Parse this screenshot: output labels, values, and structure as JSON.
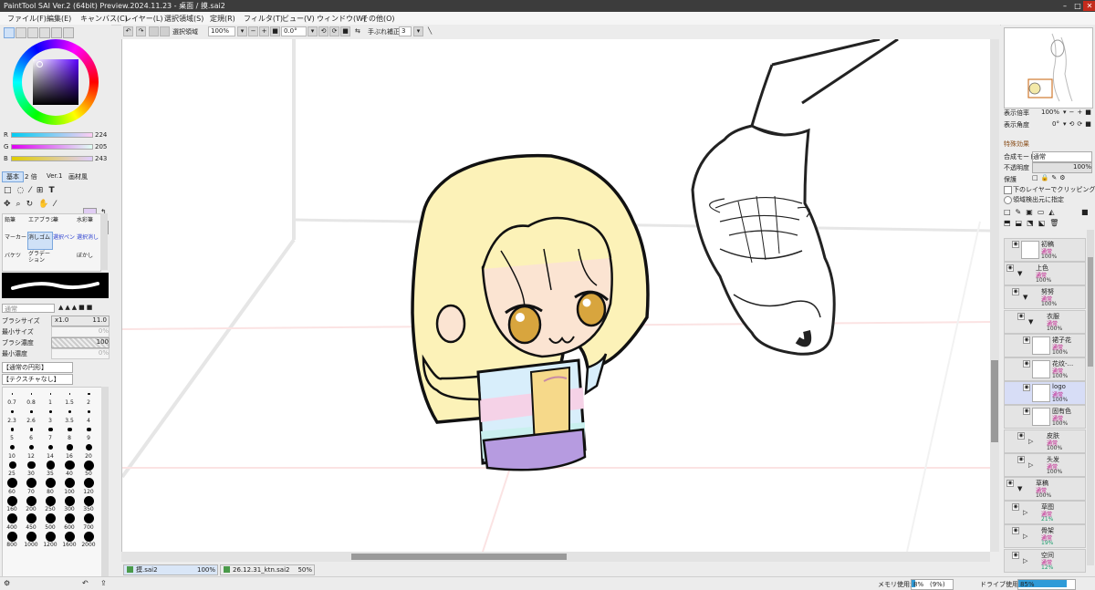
{
  "window": {
    "title": "PaintTool SAI Ver.2 (64bit) Preview.2024.11.23 - 桌面 / 摸.sai2",
    "minimize": "–",
    "maximize": "□",
    "close": "✕"
  },
  "menu": [
    "ファイル(F)",
    "編集(E)",
    "キャンバス(C)",
    "レイヤー(L)",
    "選択領域(S)",
    "定規(R)",
    "フィルタ(T)",
    "ビュー(V)",
    "ウィンドウ(W)",
    "その他(O)"
  ],
  "toolbar": {
    "selection_label": "選択領域",
    "zoom_value": "100%",
    "rotation_value": "0.0°",
    "stabilizer_label": "手ぶれ補正",
    "stabilizer_value": "3"
  },
  "color": {
    "r_label": "R",
    "r_value": "224",
    "g_label": "G",
    "g_value": "205",
    "b_label": "B",
    "b_value": "243",
    "current_color": "#e0cdf3"
  },
  "tool_tabs": [
    "基本",
    "2 倍",
    "Ver.1",
    "画材風"
  ],
  "tools": [
    "鉛筆",
    "エアブラシ",
    "筆",
    "水彩筆",
    "マーカー",
    "消しゴム",
    "選択ペン",
    "選択消し",
    "バケツ",
    "グラデーション",
    "ぼかし"
  ],
  "brush": {
    "mode": "通常",
    "size_label": "ブラシサイズ",
    "size_mult": "x1.0",
    "size_value": "11.0",
    "min_size_label": "最小サイズ",
    "min_size_value": "0%",
    "density_label": "ブラシ濃度",
    "density_value": "100",
    "min_density_label": "最小濃度",
    "min_density_value": "0%",
    "shape": "【通常の円形】",
    "texture": "【テクスチャなし】",
    "sizes": [
      "0.7",
      "0.8",
      "1",
      "1.5",
      "2",
      "2.3",
      "2.6",
      "3",
      "3.5",
      "4",
      "5",
      "6",
      "7",
      "8",
      "9",
      "10",
      "12",
      "14",
      "16",
      "20",
      "25",
      "30",
      "35",
      "40",
      "50",
      "60",
      "70",
      "80",
      "100",
      "120",
      "160",
      "200",
      "250",
      "300",
      "350",
      "400",
      "450",
      "500",
      "600",
      "700",
      "800",
      "1000",
      "1200",
      "1600",
      "2000"
    ]
  },
  "navigator": {
    "zoom_label": "表示倍率",
    "zoom_value": "100%",
    "angle_label": "表示角度",
    "angle_value": "0°"
  },
  "layer_props": {
    "effects": "特殊効果",
    "blend_label": "合成モード",
    "blend_value": "通常",
    "opacity_label": "不透明度",
    "opacity_value": "100%",
    "protect_label": "保護",
    "clip_label": "下のレイヤーでクリッピング",
    "detect_label": "領域検出元に指定"
  },
  "layers": [
    {
      "name": "初稿",
      "mode": "通常",
      "opacity": "100%",
      "folder": false
    },
    {
      "name": "上色",
      "mode": "通常",
      "opacity": "100%",
      "folder": true
    },
    {
      "name": "努努",
      "mode": "通常",
      "opacity": "100%",
      "folder": true
    },
    {
      "name": "衣服",
      "mode": "通常",
      "opacity": "100%",
      "folder": true
    },
    {
      "name": "裙子花",
      "mode": "通常",
      "opacity": "100%",
      "folder": false
    },
    {
      "name": "花纹-...",
      "mode": "通常",
      "opacity": "100%",
      "folder": false
    },
    {
      "name": "logo",
      "mode": "通常",
      "opacity": "100%",
      "folder": false
    },
    {
      "name": "固有色",
      "mode": "通常",
      "opacity": "100%",
      "folder": false
    },
    {
      "name": "皮肤",
      "mode": "通常",
      "opacity": "100%",
      "folder": true
    },
    {
      "name": "头发",
      "mode": "通常",
      "opacity": "100%",
      "folder": true
    },
    {
      "name": "草稿",
      "mode": "通常",
      "opacity": "100%",
      "folder": true
    },
    {
      "name": "草图",
      "mode": "通常",
      "opacity": "21%",
      "folder": true
    },
    {
      "name": "骨架",
      "mode": "通常",
      "opacity": "19%",
      "folder": true
    },
    {
      "name": "空间",
      "mode": "通常",
      "opacity": "12%",
      "folder": true
    }
  ],
  "tabs": [
    {
      "name": "摸.sai2",
      "zoom": "100%"
    },
    {
      "name": "26.12.31_ktn.sai2",
      "zoom": "50%"
    }
  ],
  "status": {
    "mem_label": "メモリ使用量",
    "mem_value": "8%",
    "mem_extra": "(9%)",
    "drive_label": "ドライブ使用量",
    "drive_value": "85%"
  }
}
